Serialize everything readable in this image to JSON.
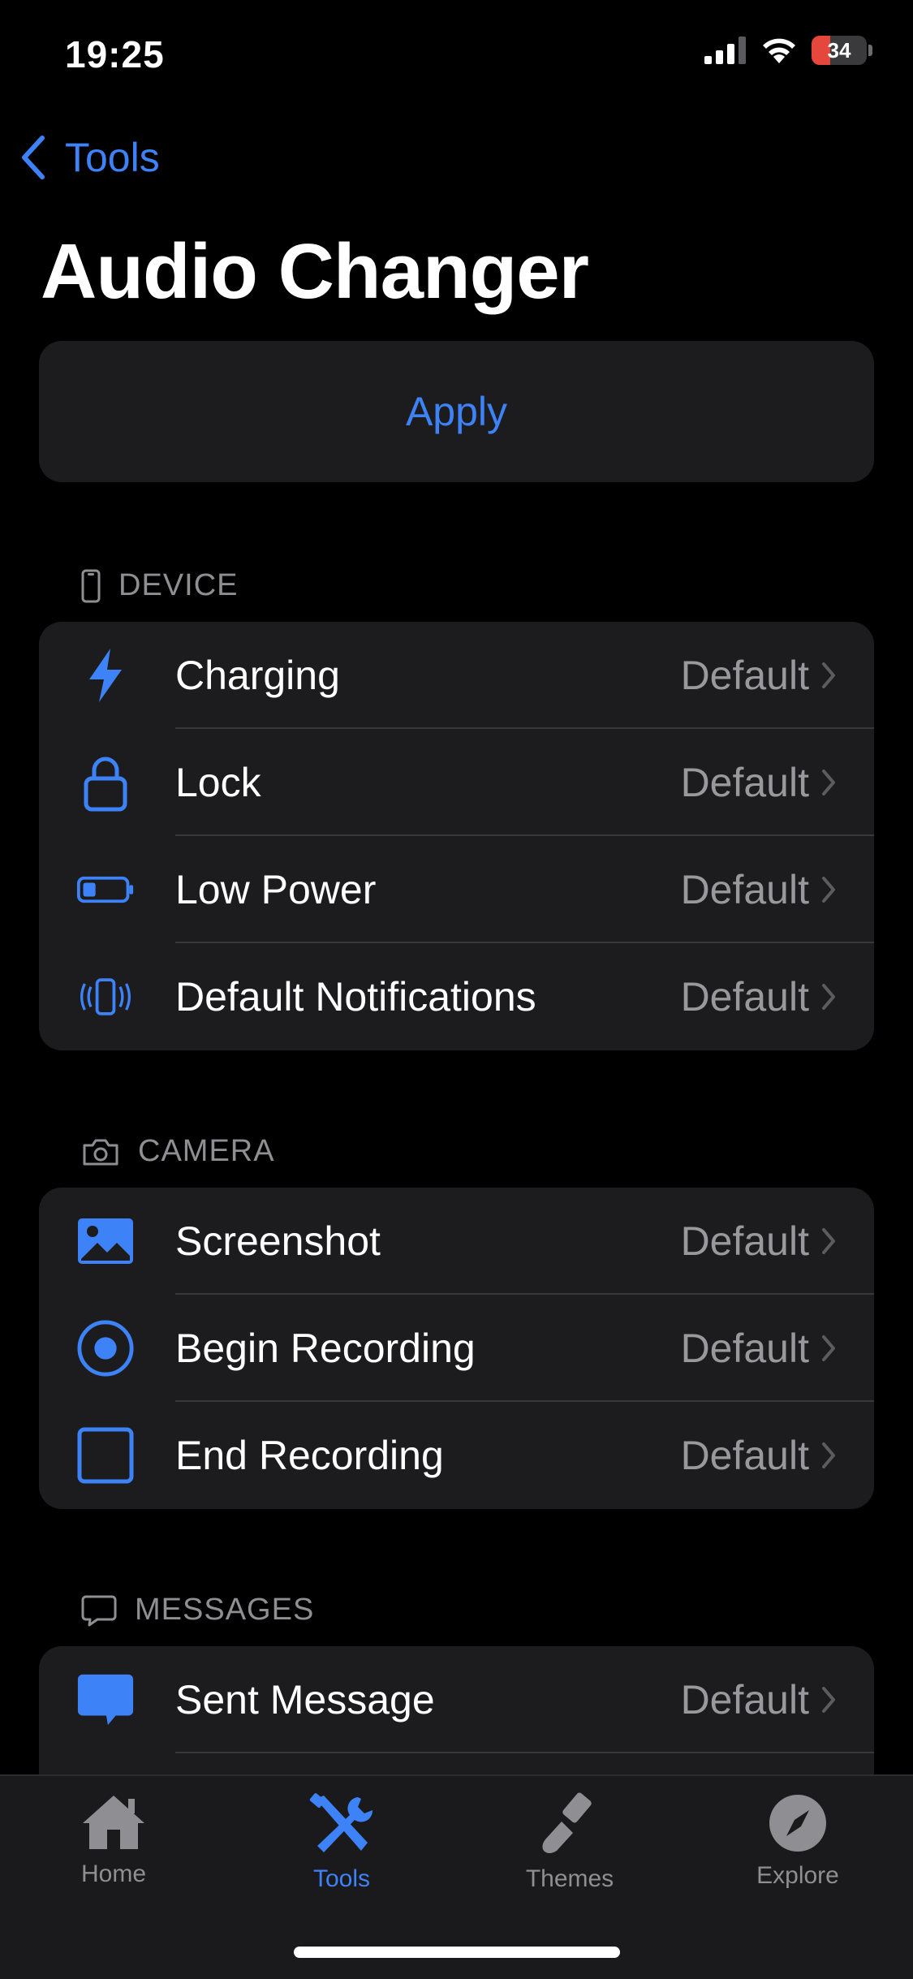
{
  "status_bar": {
    "time": "19:25",
    "battery": "34",
    "battery_level": 0.34
  },
  "nav": {
    "back_label": "Tools",
    "title": "Audio Changer"
  },
  "apply_label": "Apply",
  "sections": {
    "device": {
      "header": "DEVICE",
      "items": [
        {
          "label": "Charging",
          "value": "Default",
          "icon": "bolt-icon"
        },
        {
          "label": "Lock",
          "value": "Default",
          "icon": "lock-icon"
        },
        {
          "label": "Low Power",
          "value": "Default",
          "icon": "battery-low-icon"
        },
        {
          "label": "Default Notifications",
          "value": "Default",
          "icon": "phone-vibrate-icon"
        }
      ]
    },
    "camera": {
      "header": "CAMERA",
      "items": [
        {
          "label": "Screenshot",
          "value": "Default",
          "icon": "photo-icon"
        },
        {
          "label": "Begin Recording",
          "value": "Default",
          "icon": "record-circle-icon"
        },
        {
          "label": "End Recording",
          "value": "Default",
          "icon": "stop-square-icon"
        }
      ]
    },
    "messages": {
      "header": "MESSAGES",
      "items": [
        {
          "label": "Sent Message",
          "value": "Default",
          "icon": "message-bubble-icon"
        }
      ]
    }
  },
  "tabbar": {
    "items": [
      {
        "label": "Home",
        "icon": "house-icon",
        "active": false
      },
      {
        "label": "Tools",
        "icon": "tools-icon",
        "active": true
      },
      {
        "label": "Themes",
        "icon": "paintbrush-icon",
        "active": false
      },
      {
        "label": "Explore",
        "icon": "compass-icon",
        "active": false
      }
    ]
  },
  "colors": {
    "accent": "#3d82f7",
    "background": "#000000",
    "card": "#1c1c1e",
    "secondary_text": "#98989d",
    "battery_fill": "#e5473d"
  }
}
